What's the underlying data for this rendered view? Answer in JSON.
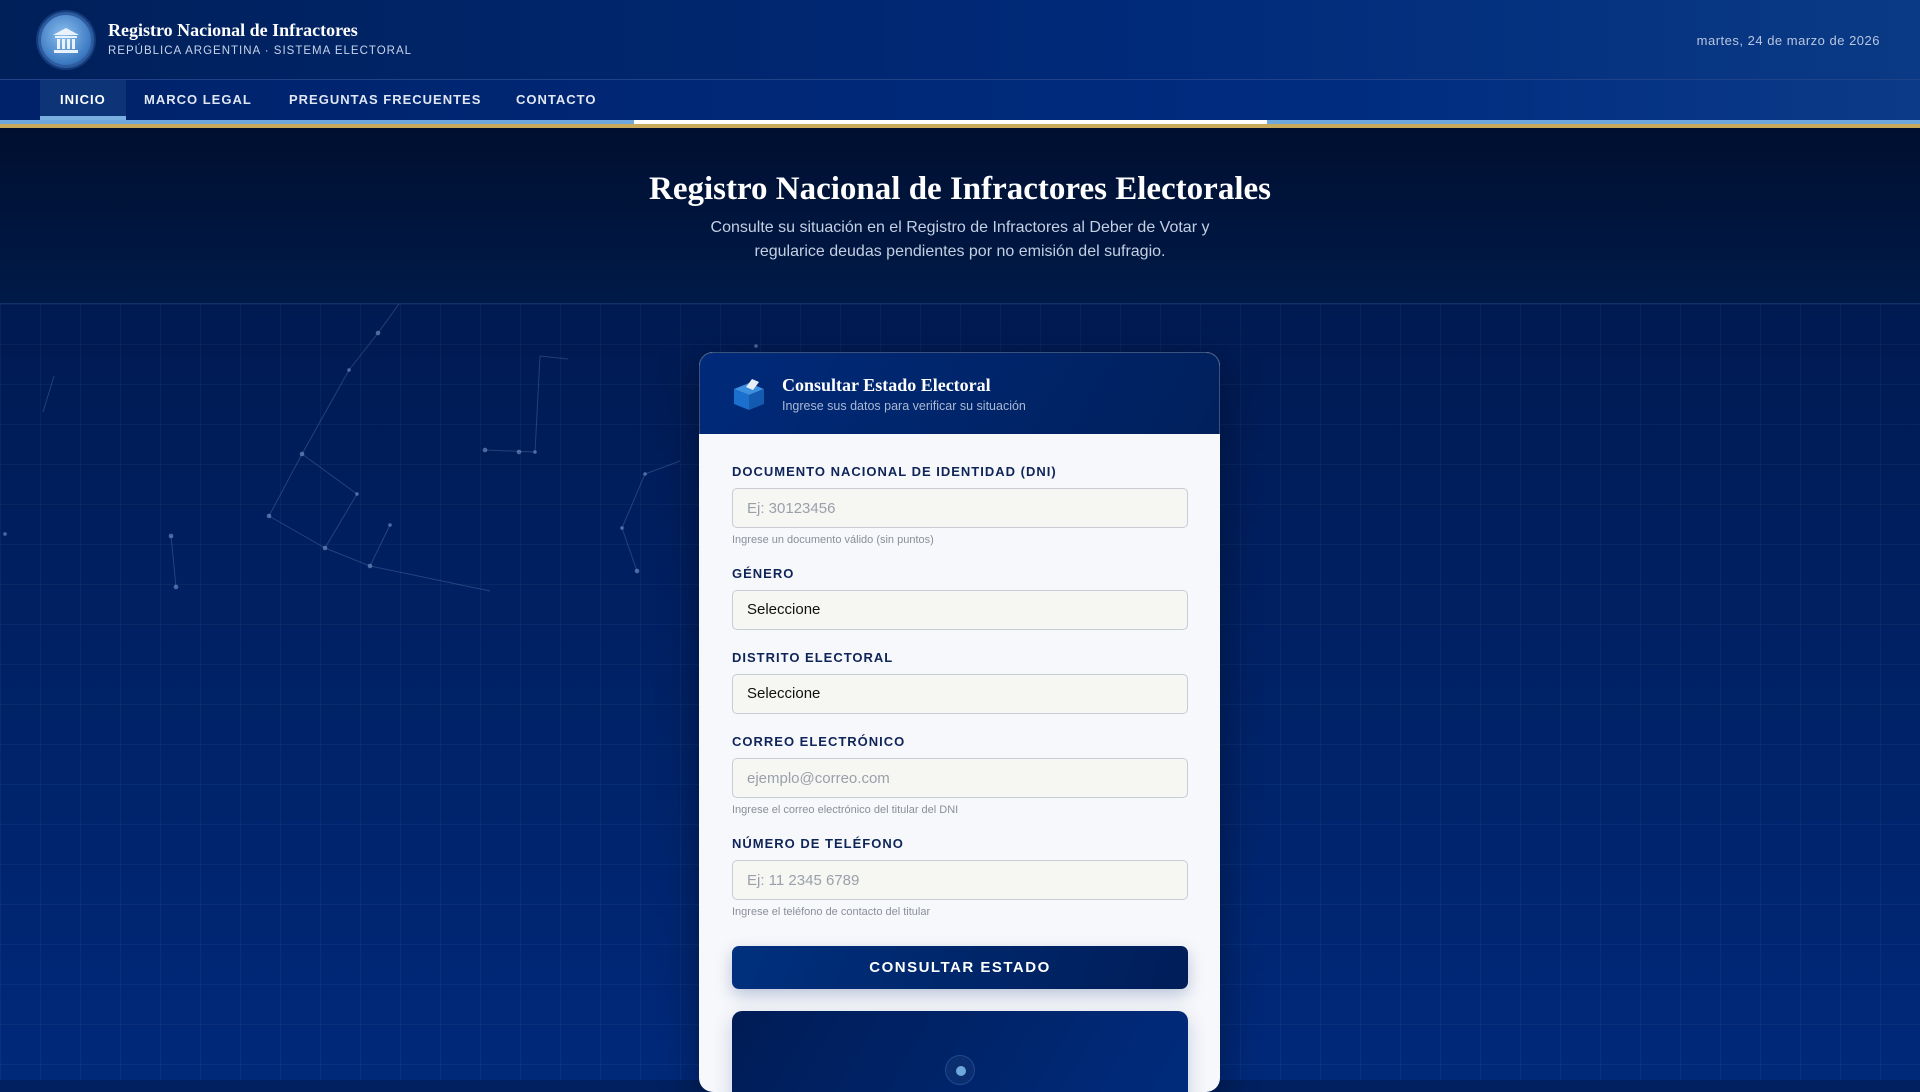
{
  "header": {
    "title": "Registro Nacional de Infractores",
    "subtitle": "REPÚBLICA ARGENTINA · SISTEMA ELECTORAL",
    "date": "martes, 24 de marzo de 2026",
    "logo_icon": "building-columns-icon"
  },
  "nav": {
    "items": [
      {
        "label": "INICIO",
        "active": true
      },
      {
        "label": "MARCO LEGAL"
      },
      {
        "label": "PREGUNTAS FRECUENTES"
      },
      {
        "label": "CONTACTO"
      }
    ]
  },
  "hero": {
    "title": "Registro Nacional de Infractores Electorales",
    "description": "Consulte su situación en el Registro de Infractores al Deber de Votar y regularice deudas pendientes por no emisión del sufragio."
  },
  "card": {
    "title": "Consultar Estado Electoral",
    "subtitle": "Ingrese sus datos para verificar su situación",
    "icon": "ballot-box-icon",
    "dni": {
      "label": "DOCUMENTO NACIONAL DE IDENTIDAD (DNI)",
      "placeholder": "Ej: 30123456",
      "hint": "Ingrese un documento válido (sin puntos)"
    },
    "genero": {
      "label": "GÉNERO",
      "value": "Seleccione"
    },
    "distrito": {
      "label": "DISTRITO ELECTORAL",
      "value": "Seleccione"
    },
    "correo": {
      "label": "CORREO ELECTRÓNICO",
      "placeholder": "ejemplo@correo.com",
      "hint": "Ingrese el correo electrónico del titular del DNI"
    },
    "telefono": {
      "label": "NÚMERO DE TELÉFONO",
      "placeholder": "Ej: 11 2345 6789",
      "hint": "Ingrese el teléfono de contacto del titular"
    },
    "submit_label": "CONSULTAR ESTADO"
  },
  "colors": {
    "primary": "#002a7a",
    "accent": "#c9a95a",
    "light_blue": "#6fa8dc"
  }
}
